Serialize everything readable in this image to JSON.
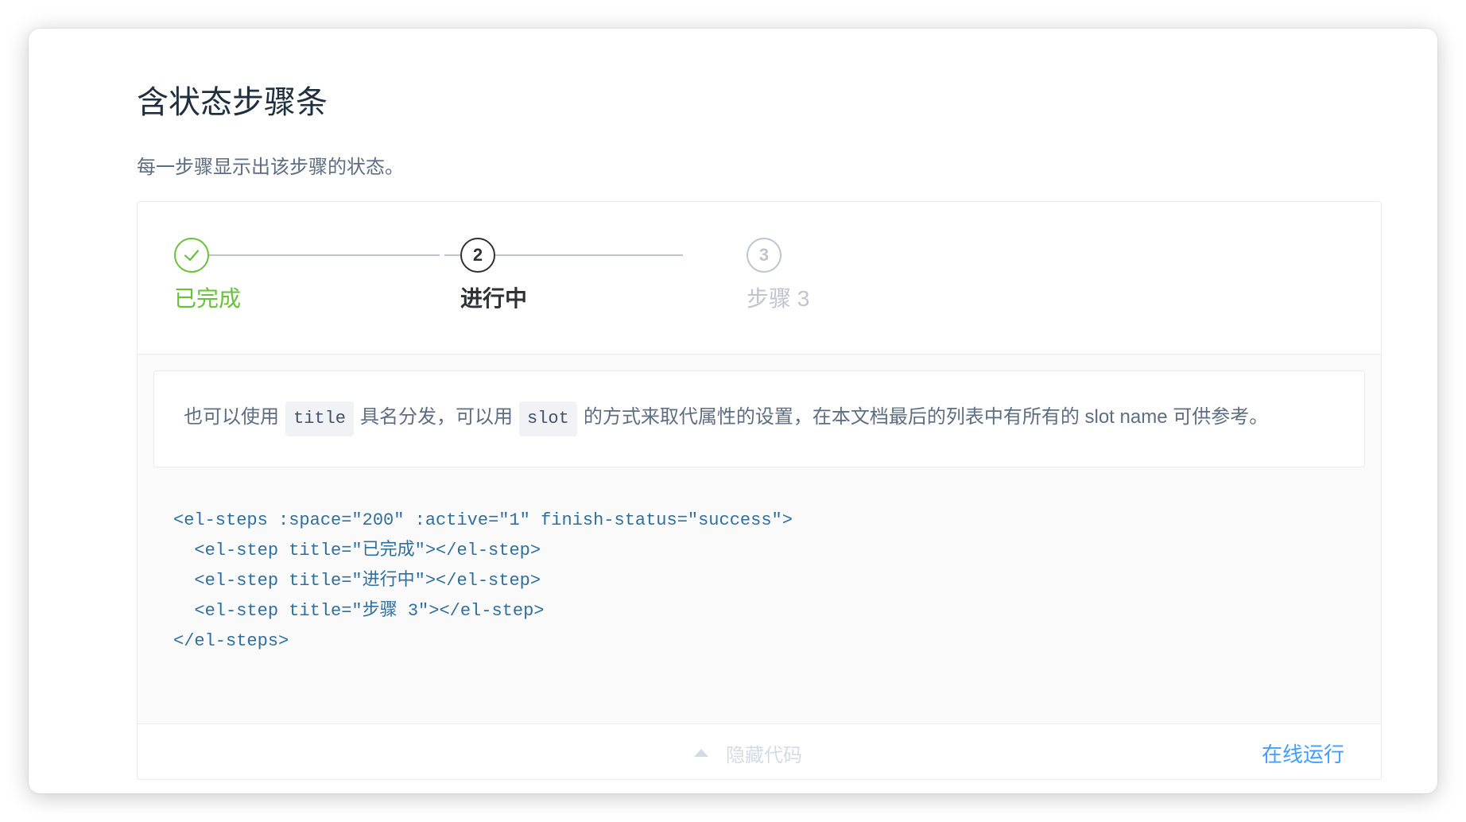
{
  "page": {
    "title": "含状态步骤条",
    "description": "每一步骤显示出该步骤的状态。"
  },
  "steps": [
    {
      "number": "",
      "title": "已完成",
      "status": "success",
      "icon": "check-icon"
    },
    {
      "number": "2",
      "title": "进行中",
      "status": "process"
    },
    {
      "number": "3",
      "title": "步骤 3",
      "status": "wait"
    }
  ],
  "tip": {
    "part1": "也可以使用",
    "code1": "title",
    "part2": "具名分发，可以用",
    "code2": "slot",
    "part3": "的方式来取代属性的设置，在本文档最后的列表中有所有的 slot name 可供参考。"
  },
  "code": {
    "lines": [
      "<el-steps :space=\"200\" :active=\"1\" finish-status=\"success\">",
      "  <el-step title=\"已完成\"></el-step>",
      "  <el-step title=\"进行中\"></el-step>",
      "  <el-step title=\"步骤 3\"></el-step>",
      "</el-steps>"
    ]
  },
  "controls": {
    "toggle_label": "隐藏代码",
    "run_label": "在线运行"
  },
  "colors": {
    "success": "#67c23a",
    "process": "#303133",
    "wait": "#c0c4cc",
    "link": "#409eff"
  }
}
